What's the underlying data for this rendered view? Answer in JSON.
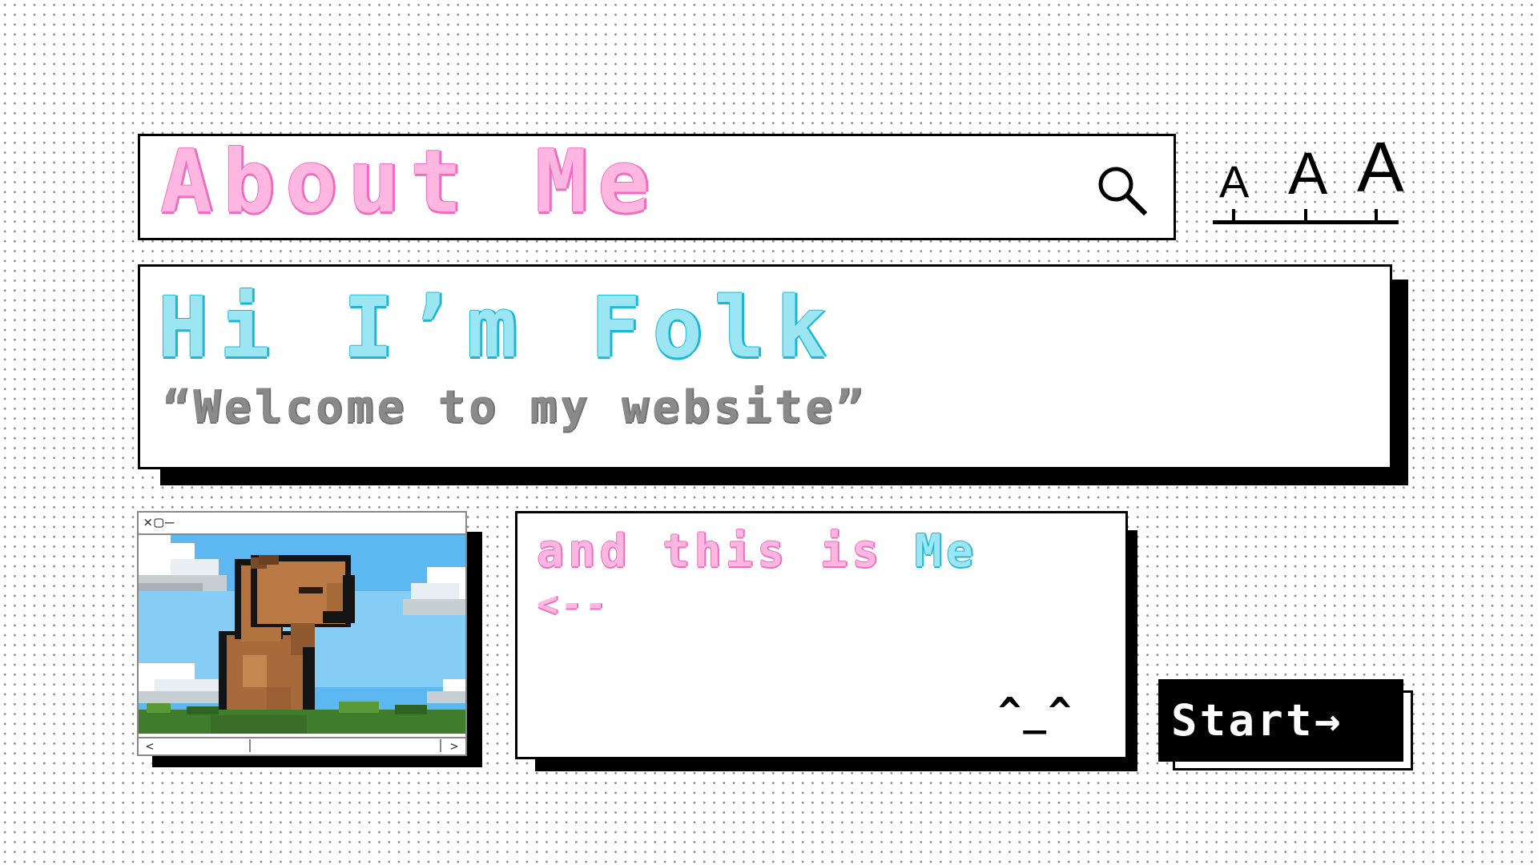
{
  "header": {
    "title": "About Me",
    "search_icon": "search-icon"
  },
  "font_size_control": {
    "small_label": "A",
    "medium_label": "A",
    "large_label": "A"
  },
  "welcome": {
    "heading": "Hi I’m Folk",
    "quote": "“Welcome to my website”"
  },
  "image_window": {
    "controls": "×▢–",
    "scroll_left": "<",
    "scroll_right": ">",
    "image": "pixel-capybara"
  },
  "me_panel": {
    "and": "and",
    "this": "this",
    "is": "is",
    "me": "Me",
    "arrow": "<--",
    "face": "^_^"
  },
  "start_button": {
    "label": "Start→"
  },
  "colors": {
    "pink_fill": "#ffb6e1",
    "pink_outline": "#f06cc0",
    "cyan_fill": "#9ce5f3",
    "cyan_outline": "#1ab8d6",
    "gray_text": "#8a8a8a"
  }
}
